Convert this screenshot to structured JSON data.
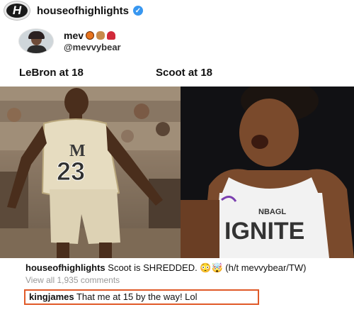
{
  "header": {
    "logo_letter": "H",
    "account": "houseofhighlights",
    "verified_icon": "verified-check-icon"
  },
  "tweet": {
    "name": "mev",
    "name_emojis": [
      "basketball-emoji-icon",
      "teddy-bear-emoji-icon",
      "rose-emoji-icon"
    ],
    "handle": "@mevvybear",
    "label_left": "LeBron at 18",
    "label_right": "Scoot at 18"
  },
  "photos": {
    "left_jersey_number": "23",
    "left_jersey_letter": "M",
    "right_jersey_league": "NBAGL",
    "right_jersey_team": "IGNITE"
  },
  "caption": {
    "author": "houseofhighlights",
    "text": "Scoot is SHREDDED. 😳🤯 (h/t mevvybear/TW)",
    "view_all": "View all 1,935 comments",
    "reply_author": "kingjames",
    "reply_text": "That me at 15 by the way! Lol"
  },
  "colors": {
    "verified": "#3897f0",
    "highlight_border": "#e05a28"
  }
}
